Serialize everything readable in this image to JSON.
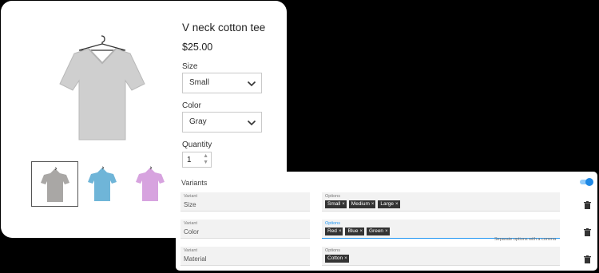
{
  "product": {
    "title": "V neck cotton tee",
    "price": "$25.00",
    "size_label": "Size",
    "size_value": "Small",
    "color_label": "Color",
    "color_value": "Gray",
    "quantity_label": "Quantity",
    "quantity_value": "1",
    "image_colors": {
      "main": "#cfcfcf",
      "gray": "#a9a7a5",
      "blue": "#6fb5d8",
      "pink": "#d7a3df"
    }
  },
  "variants": {
    "title": "Variants",
    "toggle_on": true,
    "rows": [
      {
        "variant_label": "Variant",
        "variant_value": "Size",
        "options_label": "Options",
        "chips": [
          "Small",
          "Medium",
          "Large"
        ]
      },
      {
        "variant_label": "Variant",
        "variant_value": "Color",
        "options_label": "Options",
        "chips": [
          "Red",
          "Blue",
          "Green"
        ]
      },
      {
        "variant_label": "Variant",
        "variant_value": "Material",
        "options_label": "Options",
        "chips": [
          "Cotton"
        ]
      }
    ],
    "hint": "Separate options with a comma",
    "chip_remove": "×"
  }
}
